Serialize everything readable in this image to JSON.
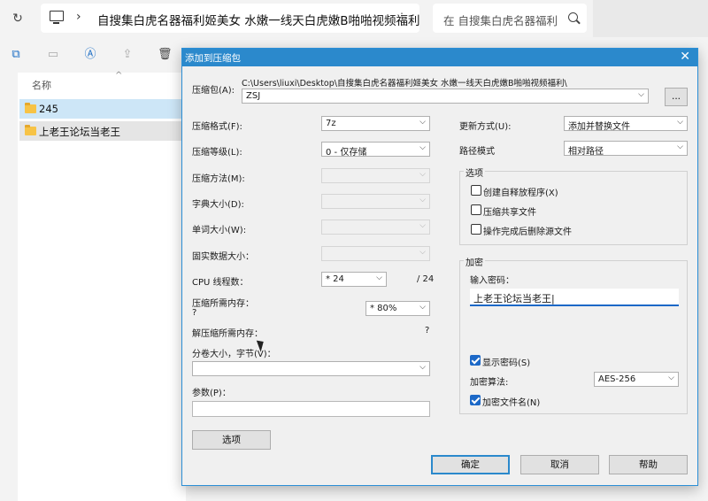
{
  "explorer": {
    "address_path": "自搜集白虎名器福利姬美女 水嫩一线天白虎嫩B啪啪视频福利",
    "address_more": "⋮",
    "search_placeholder": "在 自搜集白虎名器福利",
    "column_name": "名称",
    "folders": [
      "245",
      "上老王论坛当老王"
    ]
  },
  "dialog": {
    "title": "添加到压缩包",
    "archive_label": "压缩包(A):",
    "archive_dir": "C:\\Users\\liuxi\\Desktop\\自搜集白虎名器福利姬美女 水嫩一线天白虎嫩B啪啪视频福利\\",
    "archive_name": "ZSJ",
    "browse_label": "...",
    "format_label": "压缩格式(F):",
    "format_value": "7z",
    "level_label": "压缩等级(L):",
    "level_value": "0 - 仅存储",
    "method_label": "压缩方法(M):",
    "dict_label": "字典大小(D):",
    "word_label": "单词大小(W):",
    "solid_label": "固实数据大小：",
    "threads_label": "CPU 线程数：",
    "threads_value": "* 24",
    "threads_total": "/ 24",
    "mem_comp_label": "压缩所需内存：",
    "mem_comp_value": "?",
    "mem_comp_pct": "* 80%",
    "mem_decomp_label": "解压缩所需内存：",
    "mem_decomp_value": "?",
    "volume_label": "分卷大小，字节(V)：",
    "params_label": "参数(P)：",
    "options_button": "选项",
    "update_label": "更新方式(U):",
    "update_value": "添加并替换文件",
    "pathmode_label": "路径模式",
    "pathmode_value": "相对路径",
    "options_group": "选项",
    "opt_sfx": "创建自释放程序(X)",
    "opt_shared": "压缩共享文件",
    "opt_delete": "操作完成后删除源文件",
    "encrypt_group": "加密",
    "password_label": "输入密码：",
    "password_value": "上老王论坛当老王|",
    "show_password": "显示密码(S)",
    "enc_method_label": "加密算法:",
    "enc_method_value": "AES-256",
    "enc_names": "加密文件名(N)",
    "ok": "确定",
    "cancel": "取消",
    "help": "帮助"
  }
}
